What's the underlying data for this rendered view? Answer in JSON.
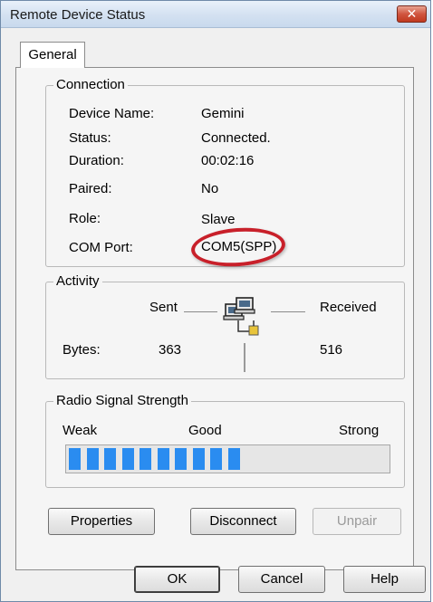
{
  "window": {
    "title": "Remote Device Status",
    "close_symbol": "✕"
  },
  "tabs": [
    {
      "label": "General"
    }
  ],
  "connection": {
    "legend": "Connection",
    "rows": [
      {
        "label": "Device Name:",
        "value": "Gemini"
      },
      {
        "label": "Status:",
        "value": "Connected."
      },
      {
        "label": "Duration:",
        "value": "00:02:16"
      },
      {
        "label": "Paired:",
        "value": "No"
      },
      {
        "label": "Role:",
        "value": "Slave"
      },
      {
        "label": "COM Port:",
        "value": "COM5(SPP)"
      }
    ],
    "highlight_color": "#c8202a"
  },
  "activity": {
    "legend": "Activity",
    "sent_label": "Sent",
    "received_label": "Received",
    "bytes_label": "Bytes:",
    "bytes_sent": "363",
    "bytes_received": "516",
    "icon": "network-computers-icon"
  },
  "signal": {
    "legend": "Radio Signal Strength",
    "weak_label": "Weak",
    "good_label": "Good",
    "strong_label": "Strong",
    "level_segments": 10,
    "bar_color": "#2a8cf0"
  },
  "buttons": {
    "properties": "Properties",
    "disconnect": "Disconnect",
    "unpair": "Unpair",
    "ok": "OK",
    "cancel": "Cancel",
    "help": "Help"
  }
}
